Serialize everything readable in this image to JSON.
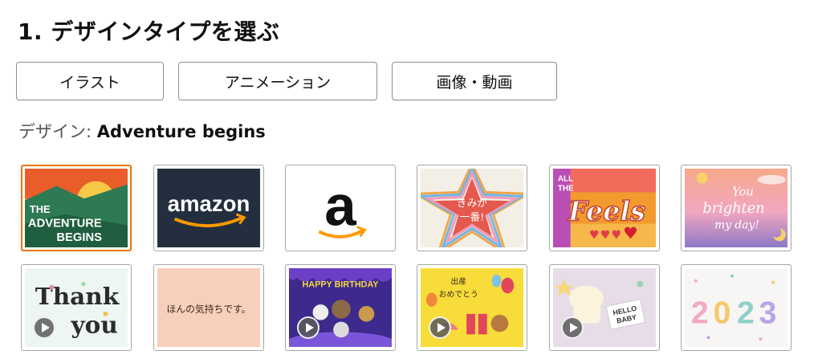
{
  "header": {
    "title": "1. デザインタイプを選ぶ"
  },
  "design_types": [
    {
      "label": "イラスト"
    },
    {
      "label": "アニメーション"
    },
    {
      "label": "画像・動画"
    }
  ],
  "selected": {
    "prefix": "デザイン:",
    "name": "Adventure begins"
  },
  "tiles": [
    {
      "text": "THE ADVENTURE BEGINS"
    },
    {
      "text": "amazon"
    },
    {
      "text": "a"
    },
    {
      "text": "きみが一番!"
    },
    {
      "text": "ALL THE Feels"
    },
    {
      "text": "You brighten my day!"
    },
    {
      "text": "Thank you"
    },
    {
      "text": "ほんの気持ちです。"
    },
    {
      "text": "HAPPY BIRTHDAY"
    },
    {
      "text": "出産おめでとう"
    },
    {
      "text": "HELLO BABY"
    },
    {
      "text": "2023"
    }
  ],
  "colors": {
    "selected_border": "#e77600",
    "amazon_dark": "#232f3e",
    "amazon_orange": "#ff9900"
  }
}
